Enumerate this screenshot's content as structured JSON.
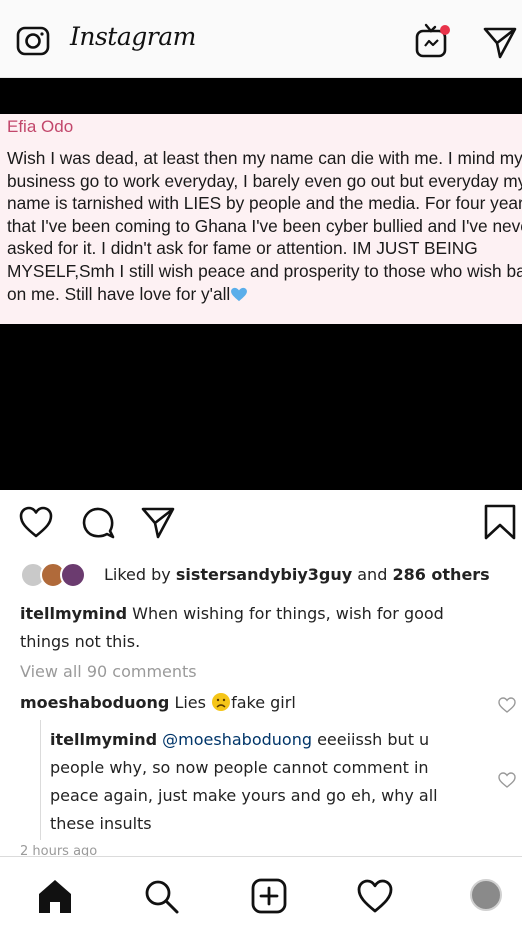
{
  "header": {
    "brand": "Instagram",
    "camera_icon": "camera-icon",
    "igtv_icon": "igtv-icon",
    "direct_icon": "direct-send-icon"
  },
  "post": {
    "author": "Efia Odo",
    "text": "Wish I was dead, at least then my name can die with me. I mind my business go to work everyday, I barely even go out but everyday my name is tarnished with LIES by people and the media. For four years that I've been coming to Ghana I've been cyber bullied and I've never asked for it. I didn't ask for fame or attention. IM JUST BEING MYSELF,Smh I still wish peace and prosperity to those who wish bad on me. Still have love for y'all",
    "background": "#fdf1f3",
    "author_color": "#c2476b"
  },
  "actions": {
    "like_icon": "heart-icon",
    "comment_icon": "comment-icon",
    "share_icon": "share-icon",
    "save_icon": "bookmark-icon"
  },
  "likes": {
    "prefix": "Liked by ",
    "user": "sistersandybiy3guy",
    "middle": " and ",
    "others": "286 others"
  },
  "caption": {
    "user": "itellmymind",
    "text": " When wishing for things, wish for good things not this."
  },
  "view_all": "View all 90 comments",
  "comments": [
    {
      "user": "moeshaboduong",
      "text_before": " Lies ",
      "text_after": "fake girl"
    }
  ],
  "reply": {
    "user": "itellmymind",
    "mention": "@moeshaboduong",
    "text": " eeeiissh but u people why, so now people cannot comment in peace again, just make yours and go eh, why all these insults"
  },
  "timestamp": "2 hours ago",
  "bottom_nav": [
    "home-icon",
    "search-icon",
    "add-post-icon",
    "activity-heart-icon",
    "profile-avatar"
  ]
}
